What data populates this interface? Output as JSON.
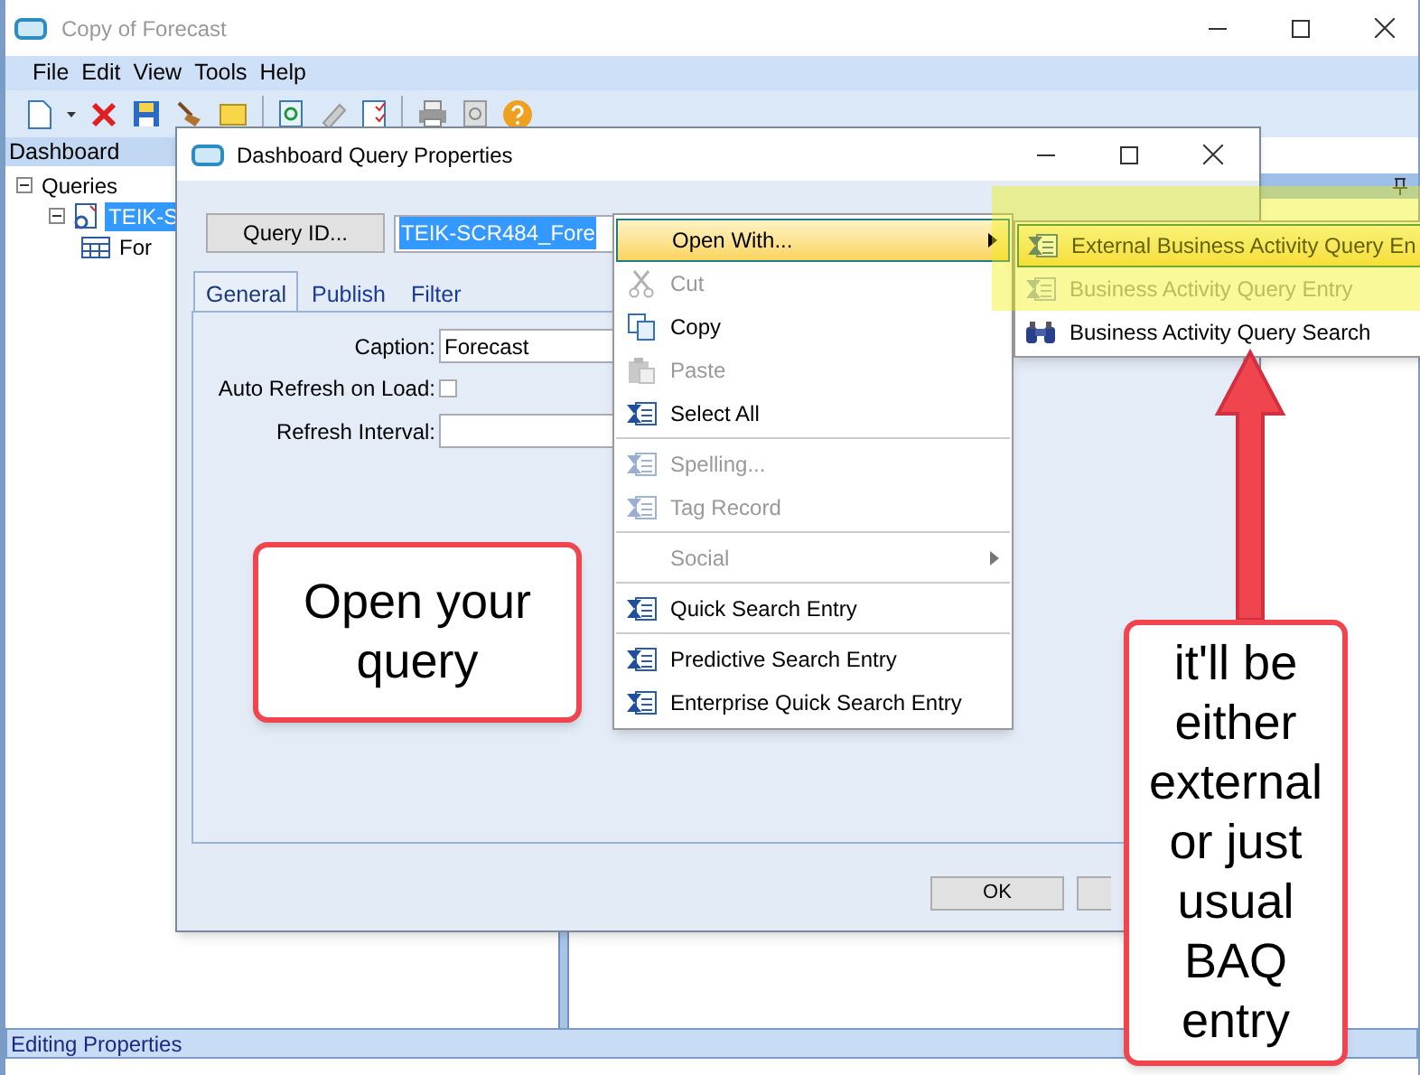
{
  "window": {
    "title": "Copy of Forecast"
  },
  "menu": [
    "File",
    "Edit",
    "View",
    "Tools",
    "Help"
  ],
  "dashboard": {
    "title": "Dashboard",
    "tree": [
      {
        "label": "Queries",
        "expanded": true,
        "selected": false,
        "children": [
          {
            "label": "TEIK-S",
            "expanded": true,
            "selected": true,
            "children": [
              {
                "label": "For",
                "selected": false
              }
            ]
          }
        ]
      }
    ]
  },
  "dialog": {
    "title": "Dashboard Query Properties",
    "query_id_button": "Query ID...",
    "query_id_value": "TEIK-SCR484_Fore",
    "tabs": [
      {
        "label": "General",
        "selected": true
      },
      {
        "label": "Publish",
        "selected": false
      },
      {
        "label": "Filter",
        "selected": false
      }
    ],
    "caption_label": "Caption:",
    "caption_value": "Forecast",
    "auto_refresh_label": "Auto Refresh on Load:",
    "auto_refresh_checked": false,
    "refresh_interval_label": "Refresh Interval:",
    "ok_button": "OK"
  },
  "context_menu": [
    {
      "label": "Open With...",
      "kind": "none",
      "selected": true,
      "disabled": false,
      "submenu": true,
      "separator_before": false
    },
    {
      "label": "Cut",
      "kind": "cut",
      "selected": false,
      "disabled": true,
      "submenu": false,
      "separator_before": false
    },
    {
      "label": "Copy",
      "kind": "copy",
      "selected": false,
      "disabled": false,
      "submenu": false,
      "separator_before": false
    },
    {
      "label": "Paste",
      "kind": "paste",
      "selected": false,
      "disabled": true,
      "submenu": false,
      "separator_before": false
    },
    {
      "label": "Select All",
      "kind": "form",
      "selected": false,
      "disabled": false,
      "submenu": false,
      "separator_before": false
    },
    {
      "label": "Spelling...",
      "kind": "form",
      "selected": false,
      "disabled": true,
      "submenu": false,
      "separator_before": true
    },
    {
      "label": "Tag Record",
      "kind": "form",
      "selected": false,
      "disabled": true,
      "submenu": false,
      "separator_before": false
    },
    {
      "label": "Social",
      "kind": "none",
      "selected": false,
      "disabled": true,
      "submenu": true,
      "separator_before": true
    },
    {
      "label": "Quick Search Entry",
      "kind": "form",
      "selected": false,
      "disabled": false,
      "submenu": false,
      "separator_before": true
    },
    {
      "label": "Predictive Search Entry",
      "kind": "form",
      "selected": false,
      "disabled": false,
      "submenu": false,
      "separator_before": true
    },
    {
      "label": "Enterprise Quick Search Entry",
      "kind": "form",
      "selected": false,
      "disabled": false,
      "submenu": false,
      "separator_before": false
    }
  ],
  "submenu": [
    {
      "label": "External Business Activity Query En",
      "kind": "form",
      "selected": true,
      "disabled": false
    },
    {
      "label": "Business Activity Query Entry",
      "kind": "form",
      "selected": false,
      "disabled": true
    },
    {
      "label": "Business Activity Query Search",
      "kind": "binoculars",
      "selected": false,
      "disabled": false
    }
  ],
  "callouts": [
    {
      "text": "Open your query"
    },
    {
      "text": "it'll be either external or just usual BAQ entry"
    }
  ],
  "status_bar": "Editing Properties"
}
